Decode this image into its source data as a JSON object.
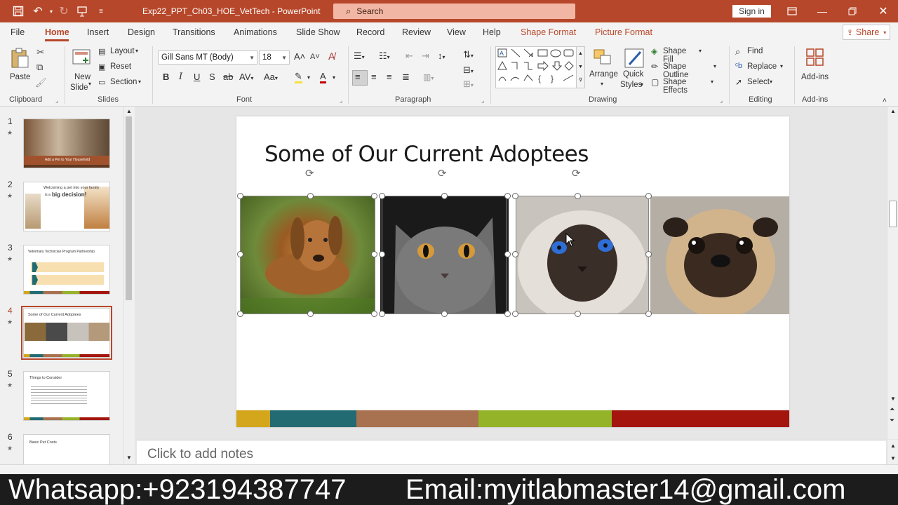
{
  "titlebar": {
    "document_title": "Exp22_PPT_Ch03_HOE_VetTech  -  PowerPoint",
    "search_placeholder": "Search",
    "signin_label": "Sign in"
  },
  "tabs": [
    "File",
    "Home",
    "Insert",
    "Design",
    "Transitions",
    "Animations",
    "Slide Show",
    "Record",
    "Review",
    "View",
    "Help",
    "Shape Format",
    "Picture Format"
  ],
  "share_label": "Share",
  "ribbon": {
    "clipboard": {
      "paste": "Paste",
      "group": "Clipboard"
    },
    "slides": {
      "new_slide_1": "New",
      "new_slide_2": "Slide",
      "layout": "Layout",
      "reset": "Reset",
      "section": "Section",
      "group": "Slides"
    },
    "font": {
      "family": "Gill Sans MT (Body)",
      "size": "18",
      "group": "Font"
    },
    "paragraph": {
      "group": "Paragraph"
    },
    "drawing": {
      "arrange": "Arrange",
      "quick_styles_1": "Quick",
      "quick_styles_2": "Styles",
      "shape_fill": "Shape Fill",
      "shape_outline": "Shape Outline",
      "shape_effects": "Shape Effects",
      "group": "Drawing"
    },
    "editing": {
      "find": "Find",
      "replace": "Replace",
      "select": "Select",
      "group": "Editing"
    },
    "addins": {
      "label": "Add-ins",
      "group": "Add-ins"
    }
  },
  "thumbnails": [
    {
      "num": "1",
      "caption": "Add a Pet to Your Household"
    },
    {
      "num": "2",
      "caption_a": "Welcoming a pet into your family",
      "caption_b": "is a",
      "caption_c": "big decision!"
    },
    {
      "num": "3",
      "caption": "Veterinary Technician Program Partnership"
    },
    {
      "num": "4",
      "caption": "Some of Our Current Adoptees"
    },
    {
      "num": "5",
      "caption": "Things to Consider"
    },
    {
      "num": "6",
      "caption": "Basic Pet Costs"
    }
  ],
  "slide": {
    "title": "Some of Our Current Adoptees"
  },
  "notes_placeholder": "Click to add notes",
  "banner": {
    "whatsapp": "Whatsapp:+923194387747",
    "email": "Email:myitlabmaster14@gmail.com"
  },
  "colors": {
    "accent": "#b7472a",
    "bar_yellow": "#d4a61c",
    "bar_teal": "#236b73",
    "bar_brown": "#a8714f",
    "bar_green": "#94b328",
    "bar_red": "#a3150d"
  }
}
